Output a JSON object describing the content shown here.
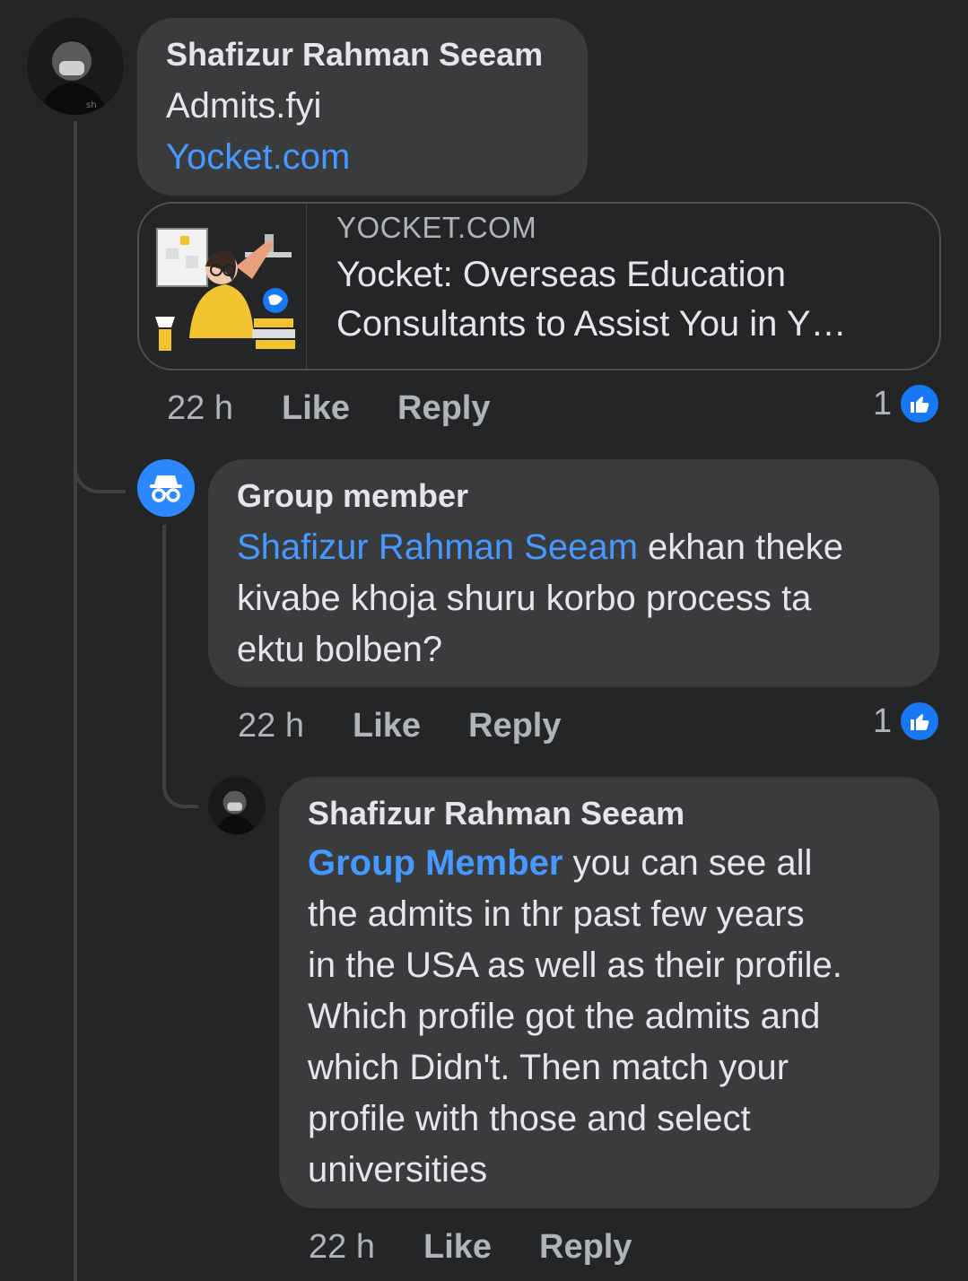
{
  "comment1": {
    "author": "Shafizur Rahman Seeam",
    "line1": "Admits.fyi",
    "link": "Yocket.com",
    "preview": {
      "domain": "YOCKET.COM",
      "title_line1": "Yocket: Overseas Education",
      "title_line2": "Consultants to Assist You in Y…"
    },
    "time": "22 h",
    "like_label": "Like",
    "reply_label": "Reply",
    "reaction_count": "1"
  },
  "comment2": {
    "author": "Group member",
    "mention": "Shafizur Rahman Seeam",
    "text_after_mention": " ekhan theke",
    "line2": "kivabe khoja shuru korbo process ta",
    "line3": "ektu bolben?",
    "time": "22 h",
    "like_label": "Like",
    "reply_label": "Reply",
    "reaction_count": "1"
  },
  "comment3": {
    "author": "Shafizur Rahman Seeam",
    "mention": "Group Member",
    "text_after_mention": " you can see all",
    "lines": [
      "the admits in thr past few years",
      "in the USA as well as their profile.",
      "Which profile got the admits and",
      "which Didn't. Then match your",
      "profile with those and select",
      "universities"
    ],
    "time": "22 h",
    "like_label": "Like",
    "reply_label": "Reply"
  },
  "colors": {
    "background": "#242526",
    "bubble": "#3a3b3c",
    "link": "#4599ff",
    "like_blue": "#1877f2"
  }
}
